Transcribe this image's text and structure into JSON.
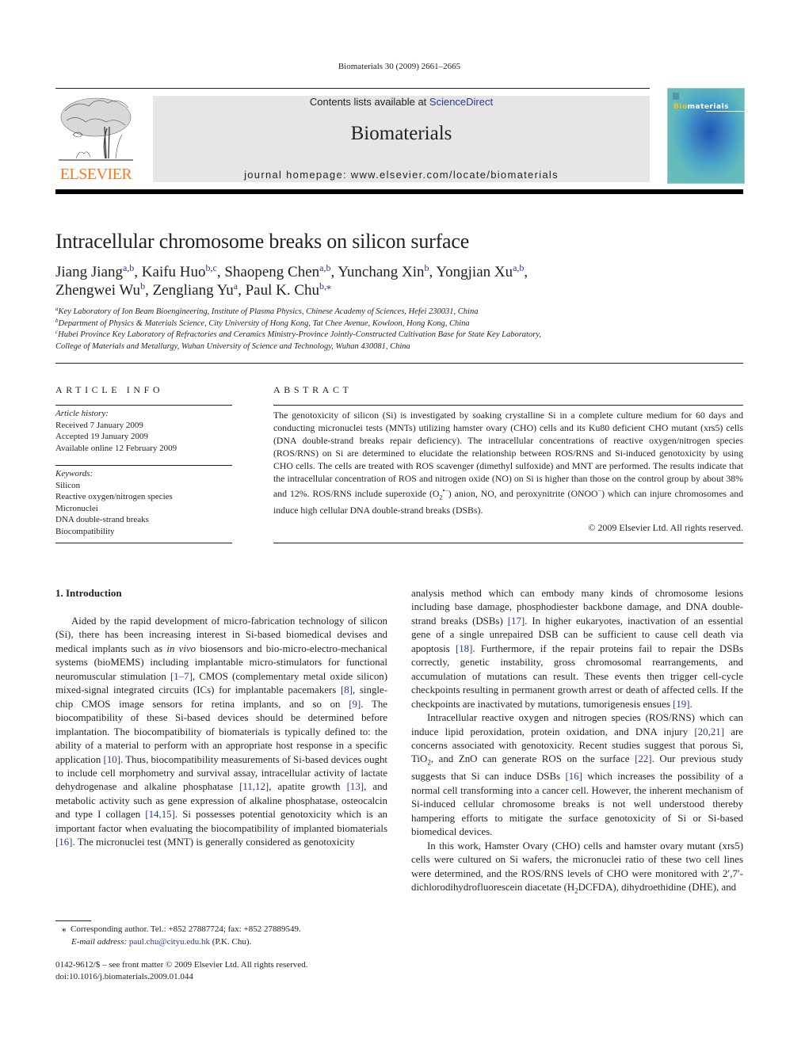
{
  "running_head": "Biomaterials 30 (2009) 2661–2665",
  "masthead": {
    "contents_prefix": "Contents lists available at ",
    "contents_link": "ScienceDirect",
    "journal_title": "Biomaterials",
    "homepage": "journal homepage: www.elsevier.com/locate/biomaterials",
    "publisher_logo_text": "ELSEVIER",
    "cover_title_accent": "Bio",
    "cover_title_rest": "materials"
  },
  "colors": {
    "link": "#2b3990",
    "elsevier_orange": "#f47b20",
    "masthead_bg": "#e6e6e7"
  },
  "article": {
    "title": "Intracellular chromosome breaks on silicon surface",
    "authors": [
      {
        "name": "Jiang Jiang",
        "aff": "a,b",
        "sep": ", "
      },
      {
        "name": "Kaifu Huo",
        "aff": "b,c",
        "sep": ", "
      },
      {
        "name": "Shaopeng Chen",
        "aff": "a,b",
        "sep": ", "
      },
      {
        "name": "Yunchang Xin",
        "aff": "b",
        "sep": ", "
      },
      {
        "name": "Yongjian Xu",
        "aff": "a,b",
        "sep": ","
      },
      {
        "name": "Zhengwei Wu",
        "aff": "b",
        "sep": ", "
      },
      {
        "name": "Zengliang Yu",
        "aff": "a",
        "sep": ", "
      },
      {
        "name": "Paul K. Chu",
        "aff": "b,⁎",
        "sep": ""
      }
    ],
    "affiliations": [
      {
        "mark": "a",
        "text": "Key Laboratory of Ion Beam Bioengineering, Institute of Plasma Physics, Chinese Academy of Sciences, Hefei 230031, China"
      },
      {
        "mark": "b",
        "text": "Department of Physics & Materials Science, City University of Hong Kong, Tat Chee Avenue, Kowloon, Hong Kong, China"
      },
      {
        "mark": "c",
        "text": "Hubei Province Key Laboratory of Refractories and Ceramics Ministry-Province Jointly-Constructed Cultivation Base for State Key Laboratory,"
      },
      {
        "mark": "",
        "text": "College of Materials and Metallurgy, Wuhan University of Science and Technology, Wuhan 430081, China"
      }
    ]
  },
  "article_info": {
    "heading": "ARTICLE INFO",
    "history_label": "Article history:",
    "history": [
      "Received 7 January 2009",
      "Accepted 19 January 2009",
      "Available online 12 February 2009"
    ],
    "keywords_label": "Keywords:",
    "keywords": [
      "Silicon",
      "Reactive oxygen/nitrogen species",
      "Micronuclei",
      "DNA double-strand breaks",
      "Biocompatibility"
    ]
  },
  "abstract": {
    "heading": "ABSTRACT",
    "text_part1": "The genotoxicity of silicon (Si) is investigated by soaking crystalline Si in a complete culture medium for 60 days and conducting micronuclei tests (MNTs) utilizing hamster ovary (CHO) cells and its Ku80 deficient CHO mutant (xrs5) cells (DNA double-strand breaks repair deficiency). The intracellular concentrations of reactive oxygen/nitrogen species (ROS/RNS) on Si are determined to elucidate the relationship between ROS/RNS and Si-induced genotoxicity by using CHO cells. The cells are treated with ROS scavenger (dimethyl sulfoxide) and MNT are performed. The results indicate that the intracellular concentration of ROS and nitrogen oxide (NO) on Si is higher than those on the control group by about 38% and 12%. ROS/RNS include superoxide (O",
    "superoxide_sub": "2",
    "superoxide_sup": "•−",
    "text_part2": ") anion, NO, and peroxynitrite (ONOO",
    "peroxynitrite_sup": "−",
    "text_part3": ") which can injure chromosomes and induce high cellular DNA double-strand breaks (DSBs).",
    "copyright": "© 2009 Elsevier Ltd. All rights reserved."
  },
  "introduction": {
    "heading": "1.  Introduction",
    "left_column": [
      {
        "t": "Aided by the rapid development of micro-fabrication technology of silicon (Si), there has been increasing interest in Si-based biomedical devises and medical implants such as "
      },
      {
        "i": "in vivo"
      },
      {
        "t": " biosensors and bio-micro-electro-mechanical systems (bioMEMS) including implantable micro-stimulators for functional neuromuscular stimulation "
      },
      {
        "r": "[1–7]"
      },
      {
        "t": ", CMOS (complementary metal oxide silicon) mixed-signal integrated circuits (ICs) for implantable pacemakers "
      },
      {
        "r": "[8]"
      },
      {
        "t": ", single-chip CMOS image sensors for retina implants, and so on "
      },
      {
        "r": "[9]"
      },
      {
        "t": ". The biocompatibility of these Si-based devices should be determined before implantation. The biocompatibility of biomaterials is typically defined to: the ability of a material to perform with an appropriate host response in a specific application "
      },
      {
        "r": "[10]"
      },
      {
        "t": ". Thus, biocompatibility measurements of Si-based devices ought to include cell morphometry and survival assay, intracellular activity of lactate dehydrogenase and alkaline phosphatase "
      },
      {
        "r": "[11,12]"
      },
      {
        "t": ", apatite growth "
      },
      {
        "r": "[13]"
      },
      {
        "t": ", and metabolic activity such as gene expression of alkaline phosphatase, osteocalcin and type I collagen "
      },
      {
        "r": "[14,15]"
      },
      {
        "t": ". Si possesses potential genotoxicity which is an important factor when evaluating the biocompatibility of implanted biomaterials "
      },
      {
        "r": "[16]"
      },
      {
        "t": ". The micronuclei test (MNT) is generally considered as genotoxicity"
      }
    ],
    "right_para1": [
      {
        "t": "analysis method which can embody many kinds of chromosome lesions including base damage, phosphodiester backbone damage, and DNA double-strand breaks (DSBs) "
      },
      {
        "r": "[17]"
      },
      {
        "t": ". In higher eukaryotes, inactivation of an essential gene of a single unrepaired DSB can be sufficient to cause cell death via apoptosis "
      },
      {
        "r": "[18]"
      },
      {
        "t": ". Furthermore, if the repair proteins fail to repair the DSBs correctly, genetic instability, gross chromosomal rearrangements, and accumulation of mutations can result. These events then trigger cell-cycle checkpoints resulting in permanent growth arrest or death of affected cells. If the checkpoints are inactivated by mutations, tumorigenesis ensues "
      },
      {
        "r": "[19]"
      },
      {
        "t": "."
      }
    ],
    "right_para2": [
      {
        "t": "Intracellular reactive oxygen and nitrogen species (ROS/RNS) which can induce lipid peroxidation, protein oxidation, and DNA injury "
      },
      {
        "r": "[20,21]"
      },
      {
        "t": " are concerns associated with genotoxicity. Recent studies suggest that porous Si, TiO"
      },
      {
        "sub": "2"
      },
      {
        "t": ", and ZnO can generate ROS on the surface "
      },
      {
        "r": "[22]"
      },
      {
        "t": ". Our previous study suggests that Si can induce DSBs "
      },
      {
        "r": "[16]"
      },
      {
        "t": " which increases the possibility of a normal cell transforming into a cancer cell. However, the inherent mechanism of Si-induced cellular chromosome breaks is not well understood thereby hampering efforts to mitigate the surface genotoxicity of Si or Si-based biomedical devices."
      }
    ],
    "right_para3": [
      {
        "t": "In this work, Hamster Ovary (CHO) cells and hamster ovary mutant (xrs5) cells were cultured on Si wafers, the micronuclei ratio of these two cell lines were determined, and the ROS/RNS levels of CHO were monitored with 2′,7′-dichlorodihydrofluorescein diacetate (H"
      },
      {
        "sub": "2"
      },
      {
        "t": "DCFDA), dihydroethidine (DHE), and"
      }
    ]
  },
  "footnote": {
    "mark": "⁎",
    "corresponding": "Corresponding author. Tel.: +852 27887724; fax: +852 27889549.",
    "email_label": "E-mail address:",
    "email": "paul.chu@cityu.edu.hk",
    "email_suffix": "(P.K. Chu)."
  },
  "front_matter": {
    "issn_line": "0142-9612/$ – see front matter © 2009 Elsevier Ltd. All rights reserved.",
    "doi": "doi:10.1016/j.biomaterials.2009.01.044"
  }
}
